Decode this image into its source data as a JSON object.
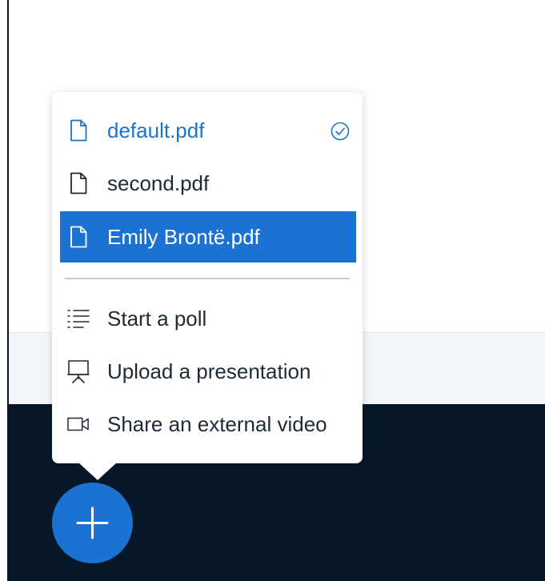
{
  "presentations": [
    {
      "label": "default.pdf",
      "icon": "file-icon",
      "state": "current"
    },
    {
      "label": "second.pdf",
      "icon": "file-icon",
      "state": "normal"
    },
    {
      "label": "Emily Brontë.pdf",
      "icon": "file-icon",
      "state": "selected"
    }
  ],
  "actions": [
    {
      "label": "Start a poll",
      "icon": "poll-list-icon"
    },
    {
      "label": "Upload a presentation",
      "icon": "presentation-board-icon"
    },
    {
      "label": "Share an external video",
      "icon": "video-camera-icon"
    }
  ],
  "current_indicator_icon": "checkmark-circle-icon",
  "fab_icon": "plus-icon",
  "colors": {
    "accent": "#1b72d3",
    "action_bar": "#06172a",
    "text": "#1f2a37",
    "divider": "#c6ccd3"
  }
}
